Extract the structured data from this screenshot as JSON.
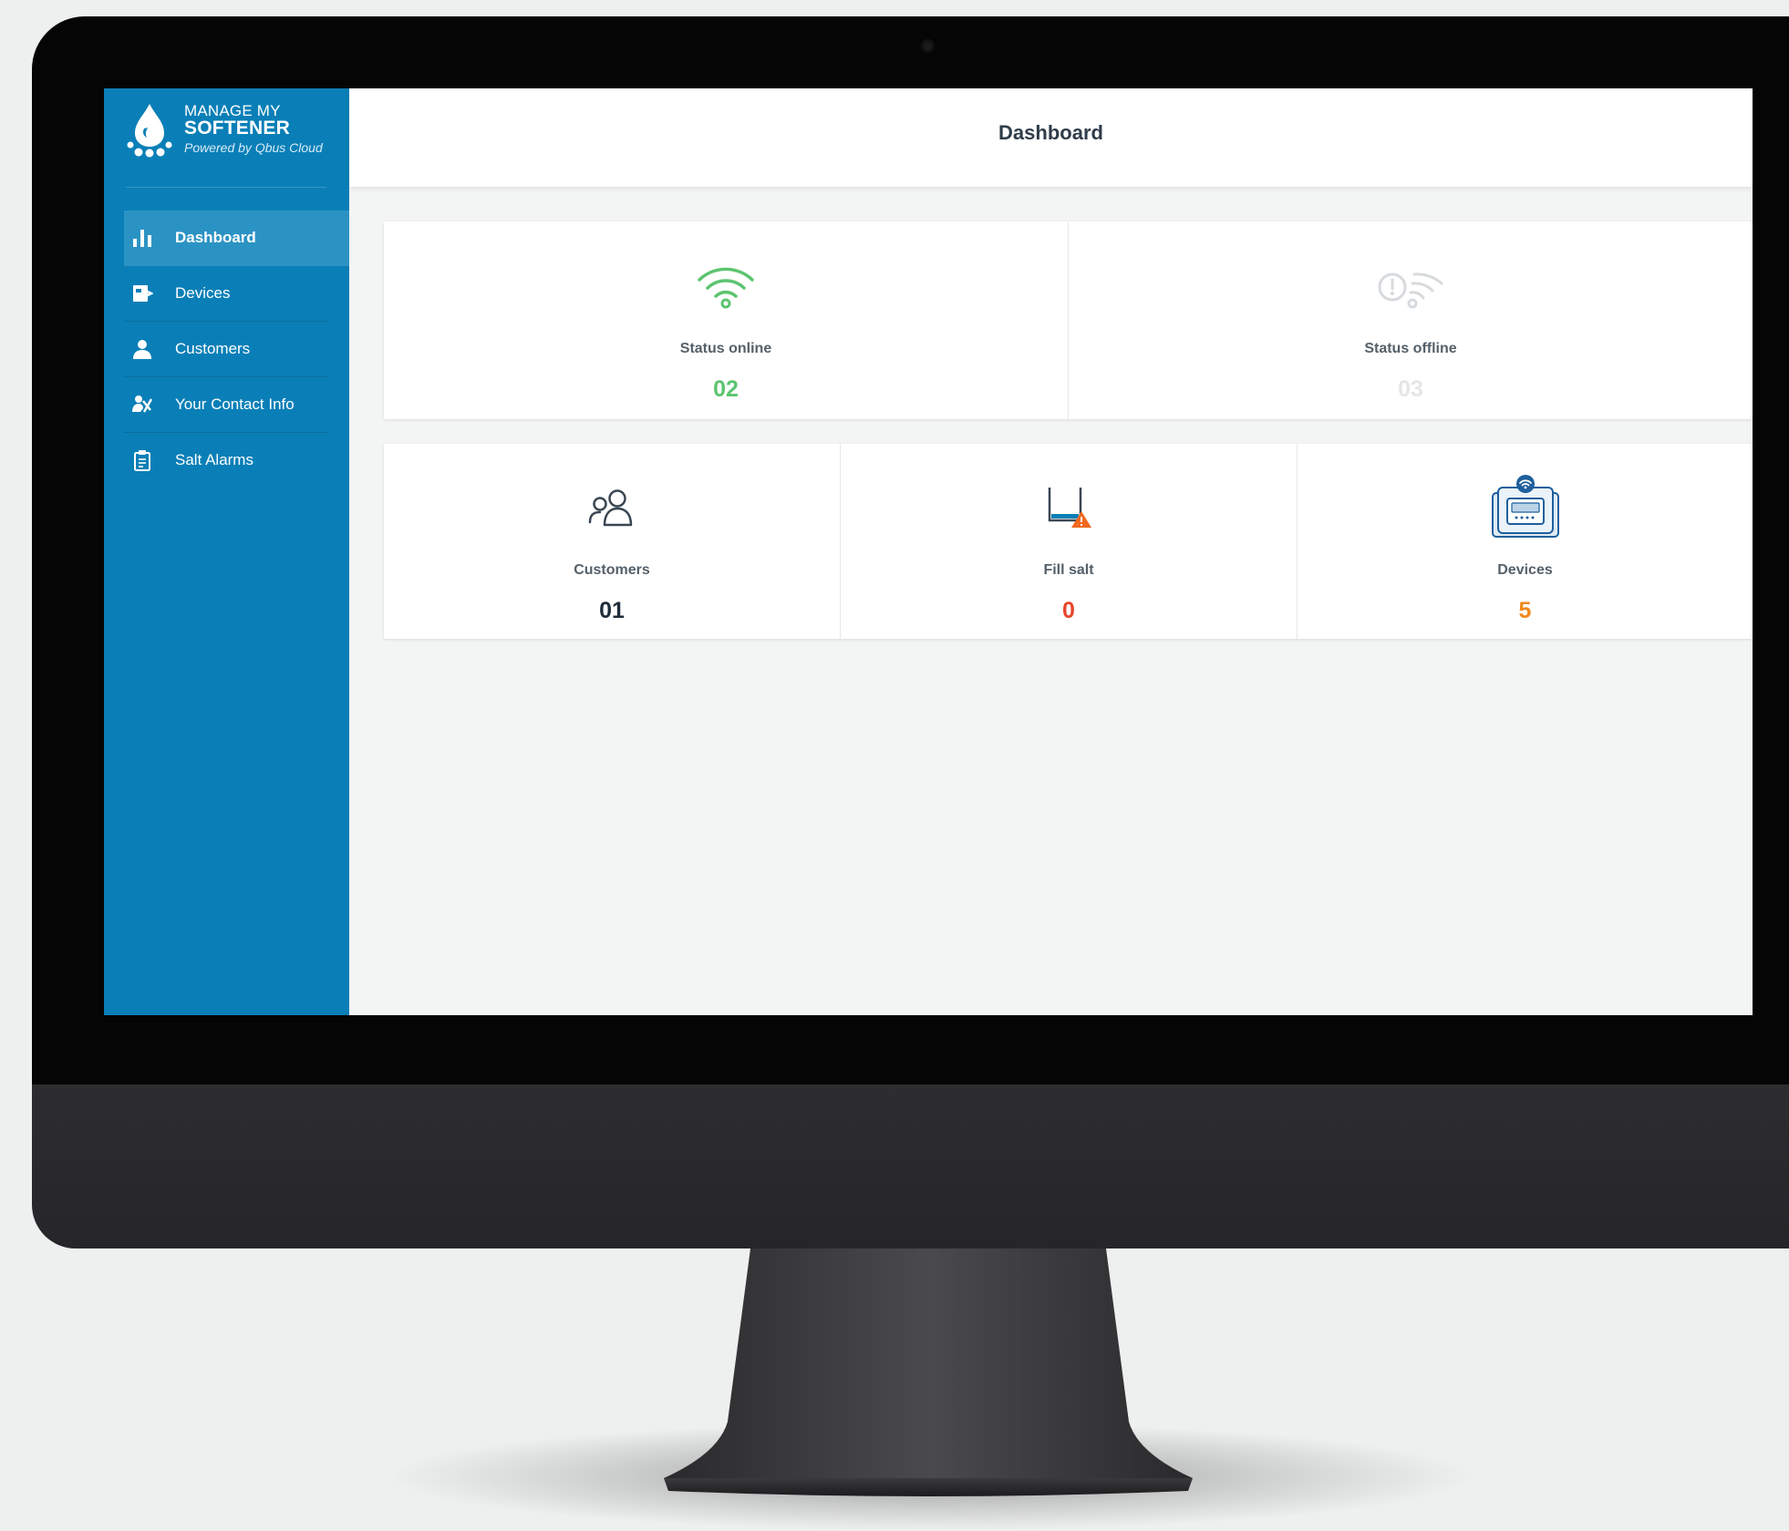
{
  "app": {
    "brand_line1": "MANAGE MY",
    "brand_line2": "SOFTENER",
    "brand_tagline": "Powered by Qbus Cloud"
  },
  "header": {
    "title": "Dashboard"
  },
  "sidebar": {
    "items": [
      {
        "label": "Dashboard",
        "icon": "bar-chart-icon",
        "active": true
      },
      {
        "label": "Devices",
        "icon": "device-icon",
        "active": false
      },
      {
        "label": "Customers",
        "icon": "user-icon",
        "active": false
      },
      {
        "label": "Your Contact Info",
        "icon": "contact-tools-icon",
        "active": false
      },
      {
        "label": "Salt Alarms",
        "icon": "clipboard-icon",
        "active": false
      }
    ]
  },
  "status_cards": [
    {
      "label": "Status online",
      "value": "02",
      "icon": "wifi-icon",
      "color": "#5cc46f"
    },
    {
      "label": "Status offline",
      "value": "03",
      "icon": "wifi-off-alert-icon",
      "color": "#e3e5e7"
    }
  ],
  "summary_cards": [
    {
      "label": "Customers",
      "value": "01",
      "icon": "users-icon",
      "color": "#1f2d3a"
    },
    {
      "label": "Fill salt",
      "value": "0",
      "icon": "salt-tank-warning-icon",
      "color": "#e8452b"
    },
    {
      "label": "Devices",
      "value": "5",
      "icon": "softener-device-icon",
      "color": "#f08a1c"
    }
  ],
  "colors": {
    "sidebar": "#0a7fb7",
    "sidebar_active": "#2b93c4",
    "background": "#f3f4f4"
  }
}
